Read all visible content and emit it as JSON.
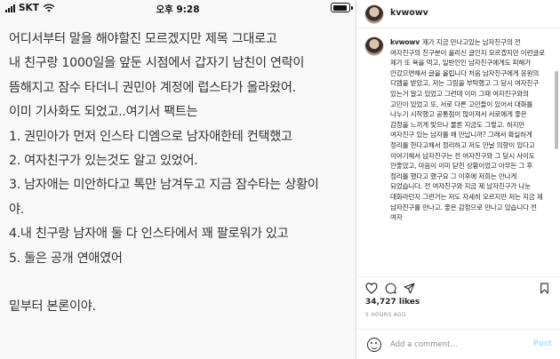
{
  "status_bar": {
    "carrier": "SKT",
    "time": "오후 9:28",
    "battery_level": 0.95
  },
  "note": {
    "lines": [
      "어디서부터 말을 해야할진 모르겠지만 제목 그대로고",
      "내 친구랑 1000일을 앞둔 시점에서 갑자기 남친이 연락이",
      "뜸해지고 잠수 타더니 권민아 계정에 럽스타가 올라왔어.",
      "이미 기사화도 되었고..여기서 팩트는",
      "1. 권민아가 먼저 인스타 디엠으로 남자애한테 컨택했고",
      "2. 여자친구가 있는것도 알고 있었어.",
      "3. 남자애는 미안하다고 톡만 남겨두고 지금 잠수타는 상황이",
      "야.",
      "4.내 친구랑 남자애 둘 다 인스타에서 꽤 팔로워가 있고",
      "5. 둘은 공개 연애였어"
    ],
    "last_line": "밑부터 본론이야."
  },
  "instagram": {
    "username": "kvwowv",
    "caption_username": "kvwowv",
    "caption": "제가 지금 만나고있는 남자친구의 전 여자친구의 친구분이 올리신 글인지 모르겠지만 이런글로 제가 또 욕을 먹고, 일반인인 남자친구에게도 피해가 안갔으면해서 글을 올립니다 처음 남자친구에게 응원의 디엠을 받았고, 저는 그림을 부탁했고 그 당시 여자친구 있는거 알고 있었고 그런데 이미 그때 여자친구와의 고민이 있었고 또, 서로 다른 고민들이 있어서 대화를 나누기 시작했고 공통점이 많아져서 서로에게 좋은 감정을 느끼게 맞으나 물론 지금도 그렇고. 하지만 여자친구 있는 남자를 왜 만납니까? 그래서 확실하게 정리를 한다고해서 정리하고 저도 만날 의향이 있다고 이야기해서 남자친구는 전 여자친구와 그 당시 사이도 안좋았고, 마음이 이미 닫힌 상황이었고 아무든 그 후 정리를 했다고 했구요 그 이후에 저희는 만나게 되었습니다. 전 여자친구와 지금 제 남자친구가 나눈 대화라던지 그런거는 저도 자세히 모르지만 저는 지금 제 남자친구를 만나고. 좋은 감정으로 만나고 있습니다 전 여자",
    "likes": "34,727 likes",
    "time_ago": "5 HOURS AGO",
    "comment_placeholder": "Add a comment...",
    "post_label": "Post",
    "icons": [
      "heart-icon",
      "comment-icon",
      "share-icon",
      "bookmark-icon",
      "emoji-icon"
    ],
    "accent_color": "#b2dffc"
  }
}
